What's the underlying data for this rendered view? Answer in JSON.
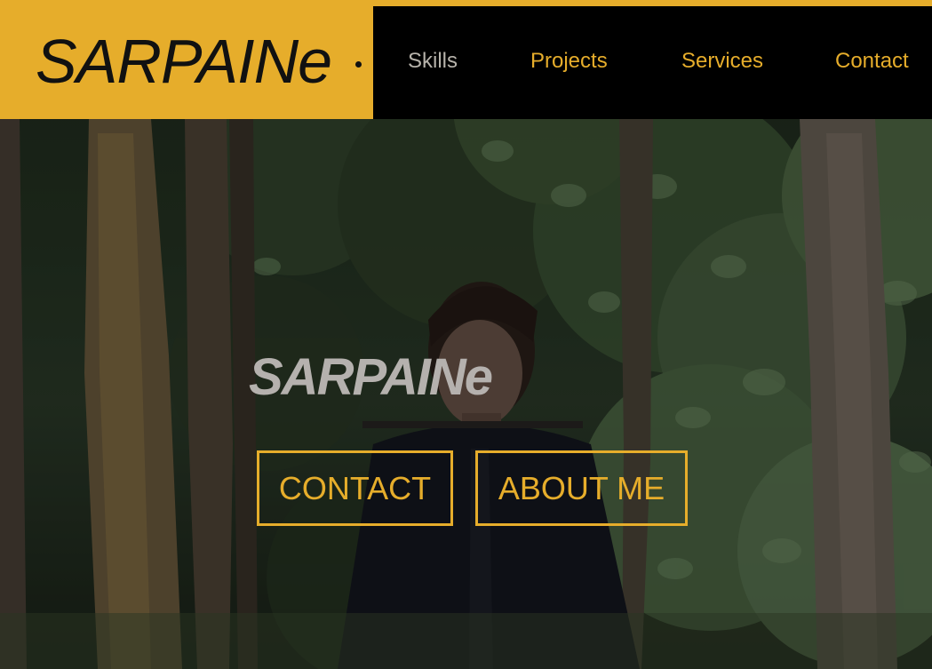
{
  "brand": {
    "title": "SARPAINe"
  },
  "nav": {
    "items": [
      {
        "label": "Skills",
        "active": true
      },
      {
        "label": "Projects"
      },
      {
        "label": "Services"
      },
      {
        "label": "Contact"
      }
    ]
  },
  "hero": {
    "title": "SARPAINe",
    "buttons": {
      "contact_label": "CONTACT",
      "about_label": "ABOUT ME"
    }
  },
  "colors": {
    "accent": "#e6ad2b",
    "nav_background": "#000000",
    "brand_text": "#111111",
    "nav_muted": "#b7b3ab"
  }
}
